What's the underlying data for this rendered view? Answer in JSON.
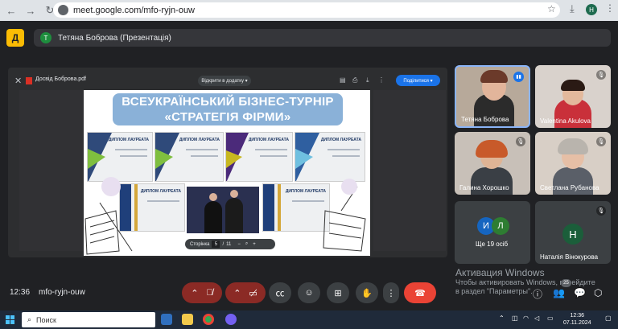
{
  "browser": {
    "url": "meet.google.com/mfo-ryjn-ouw",
    "profile_initial": "H"
  },
  "meet": {
    "logo_letter": "Д",
    "presenter_initial": "T",
    "presenter_label": "Тетяна Боброва (Презентація)"
  },
  "share": {
    "file_name": "Досвід Боброва.pdf",
    "open_with_label": "Відкрити в додатку ▾",
    "share_button_label": "Поділитися ▾",
    "slide_title_line1": "ВСЕУКРАЇНСЬКИЙ БІЗНЕС-ТУРНІР",
    "slide_title_line2": "«СТРАТЕГІЯ ФІРМИ»",
    "diploma_label": "ДИПЛОМ ЛАУРЕАТА",
    "pager_label": "Сторінка",
    "pager_current": "5",
    "pager_separator": "/",
    "pager_total": "11"
  },
  "participants": [
    {
      "name": "Тетяна Боброва"
    },
    {
      "name": "Valentina Akulova"
    },
    {
      "name": "Галина Хорошко"
    },
    {
      "name": "Светлана Рубанова"
    },
    {
      "name": "Ще 19 осіб",
      "avatar1": "И",
      "avatar2": "Л"
    },
    {
      "name": "Наталія Вінокурова",
      "avatar": "Н"
    }
  ],
  "activation": {
    "title": "Активация Windows",
    "text": "Чтобы активировать Windows, перейдите в раздел \"Параметры\"."
  },
  "bottom_bar": {
    "time": "12:36",
    "meeting_code": "mfo-ryjn-ouw",
    "participant_count": "25"
  },
  "taskbar": {
    "search_label": "Поиск",
    "clock_time": "12:36",
    "clock_date": "07.11.2024"
  }
}
